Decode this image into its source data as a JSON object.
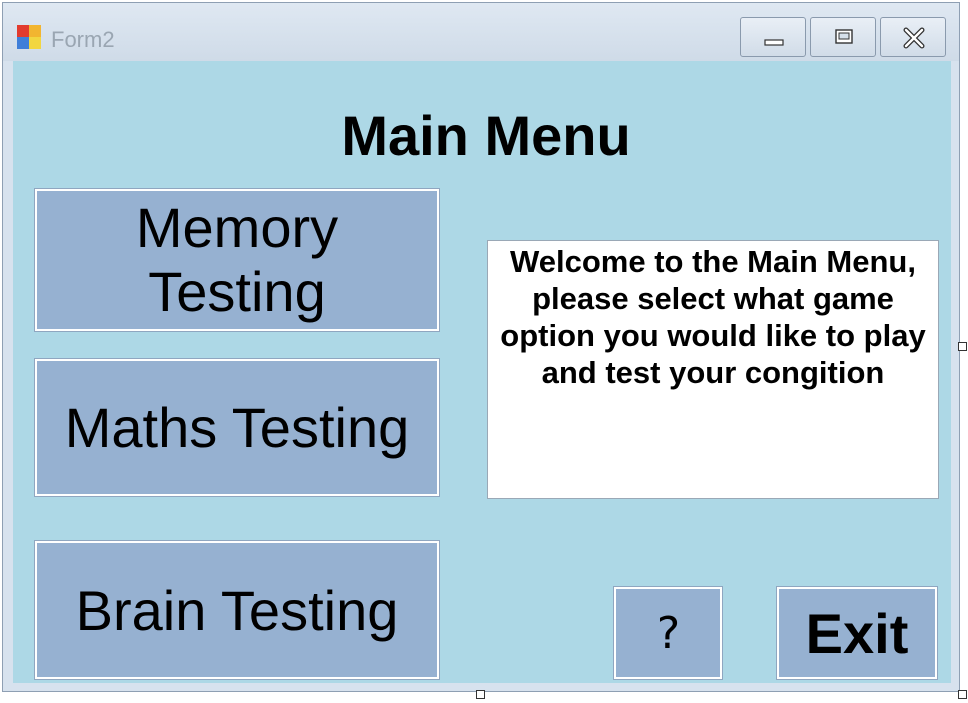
{
  "window": {
    "title": "Form2",
    "minimize_icon": "minimize-icon",
    "maximize_icon": "maximize-icon",
    "close_icon": "close-icon"
  },
  "main": {
    "heading": "Main Menu",
    "buttons": {
      "memory_line1": "Memory",
      "memory_line2": "Testing",
      "maths": "Maths Testing",
      "brain": "Brain Testing",
      "help": "?",
      "exit": "Exit"
    },
    "welcome_text": "Welcome to the Main Menu, please select what game option you would like to play and test your congition"
  },
  "colors": {
    "form_background": "#add8e6",
    "button_background": "#96b1d1",
    "textbox_background": "#ffffff"
  }
}
